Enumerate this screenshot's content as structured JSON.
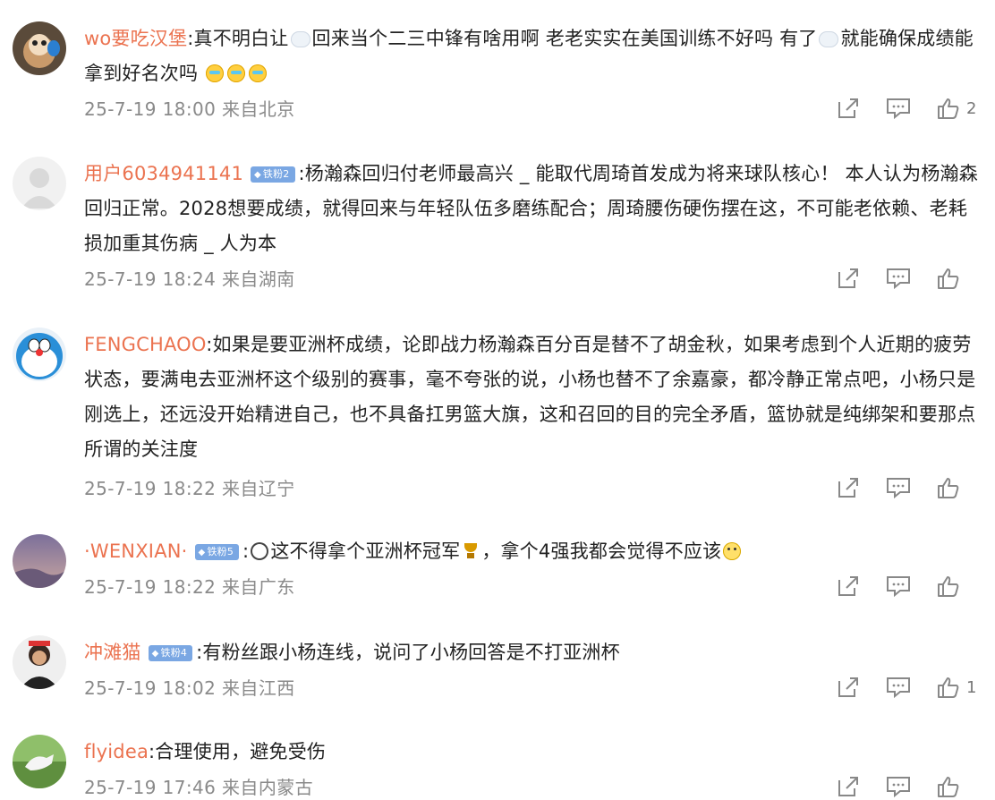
{
  "comments": [
    {
      "username": "wo要吃汉堡",
      "badge": "",
      "text_parts": [
        ":真不明白让",
        "回来当个二三中锋有啥用啊 老老实实在美国训练不好吗 有了",
        "就能确保成绩能拿到好名次吗"
      ],
      "emoji_end": [
        "cry",
        "cry",
        "cry"
      ],
      "time": "25-7-19 18:00",
      "location": "来自北京",
      "likes": "2"
    },
    {
      "username": "用户6034941141",
      "badge": "铁粉2",
      "text": ":杨瀚森回归付老师最高兴 _ 能取代周琦首发成为将来球队核心！ 本人认为杨瀚森回归正常。2028想要成绩，就得回来与年轻队伍多磨练配合；周琦腰伤硬伤摆在这，不可能老依赖、老耗损加重其伤病 _ 人为本",
      "time": "25-7-19 18:24",
      "location": "来自湖南",
      "likes": ""
    },
    {
      "username": "FENGCHAOO",
      "badge": "",
      "text": ":如果是要亚洲杯成绩，论即战力杨瀚森百分百是替不了胡金秋，如果考虑到个人近期的疲劳状态，要满电去亚洲杯这个级别的赛事，毫不夸张的说，小杨也替不了余嘉豪，都冷静正常点吧，小杨只是刚选上，还远没开始精进自己，也不具备扛男篮大旗，这和召回的目的完全矛盾，篮协就是纯绑架和要那点所谓的关注度",
      "time": "25-7-19 18:22",
      "location": "来自辽宁",
      "likes": ""
    },
    {
      "username": "·WENXIAN·",
      "badge": "铁粉5",
      "text_a": ":",
      "text_b": "这不得拿个亚洲杯冠军",
      "text_c": "，拿个4强我都会觉得不应该",
      "time": "25-7-19 18:22",
      "location": "来自广东",
      "likes": ""
    },
    {
      "username": "冲滩猫",
      "badge": "铁粉4",
      "text": ":有粉丝跟小杨连线，说问了小杨回答是不打亚洲杯",
      "time": "25-7-19 18:02",
      "location": "来自江西",
      "likes": "1"
    },
    {
      "username": "flyidea",
      "badge": "",
      "text": ":合理使用，避免受伤",
      "time": "25-7-19 17:46",
      "location": "来自内蒙古",
      "likes": ""
    }
  ],
  "icons": {
    "share": "share-icon",
    "comment": "comment-icon",
    "like": "thumbs-up-icon"
  },
  "colors": {
    "username": "#eb7350",
    "meta": "#8a8a8a",
    "badge": "#7aa7e3"
  }
}
